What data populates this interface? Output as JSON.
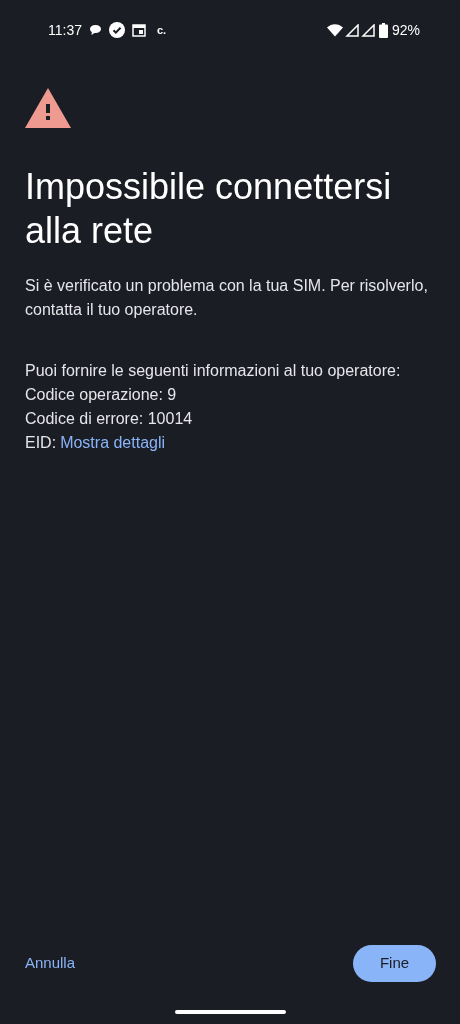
{
  "status_bar": {
    "time": "11:37",
    "carrier_mark": "c.",
    "battery": "92%"
  },
  "title": "Impossibile connettersi alla rete",
  "message": "Si è verificato un problema con la tua SIM. Per risolverlo, contatta il tuo operatore.",
  "info_lines": [
    "Puoi fornire le seguenti informazioni al tuo operatore:",
    "Codice operazione: 9",
    "Codice di errore: 10014"
  ],
  "eid": {
    "label": "EID:",
    "link": "Mostra dettagli"
  },
  "buttons": {
    "cancel": "Annulla",
    "done": "Fine"
  }
}
